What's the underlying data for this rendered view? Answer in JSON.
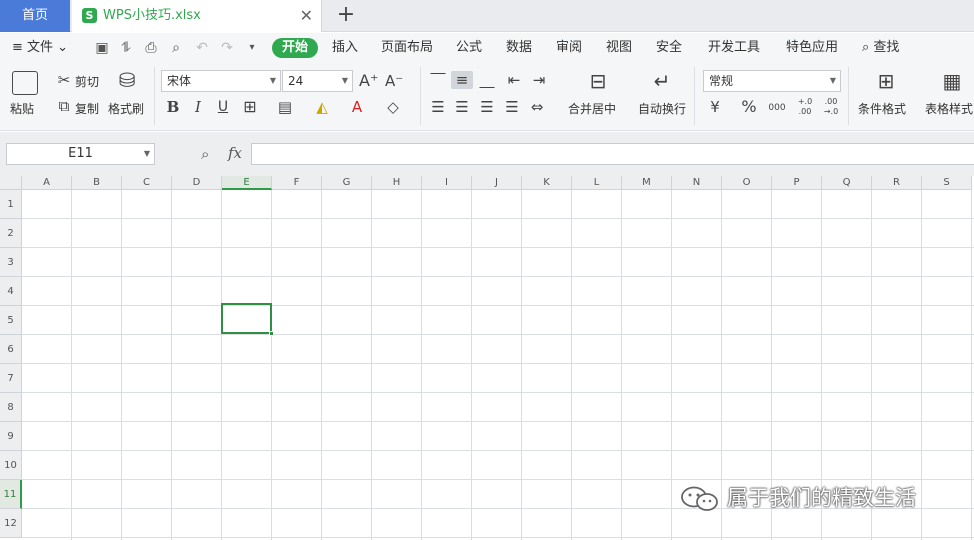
{
  "tabs": {
    "home": "首页",
    "file_name": "WPS小技巧.xlsx",
    "file_icon": "S"
  },
  "menu": {
    "file": "≡ 文件 ⌄",
    "tabs": [
      "开始",
      "插入",
      "页面布局",
      "公式",
      "数据",
      "审阅",
      "视图",
      "安全",
      "开发工具",
      "特色应用"
    ],
    "active_tab": "开始",
    "search": "查找"
  },
  "ribbon": {
    "paste": "粘贴",
    "cut": "剪切",
    "copy": "复制",
    "format_painter": "格式刷",
    "font_name": "宋体",
    "font_size": "24",
    "bold": "B",
    "italic": "I",
    "underline": "U",
    "merge_center": "合并居中",
    "wrap_text": "自动换行",
    "number_format": "常规",
    "conditional_format": "条件格式",
    "table_style": "表格样式",
    "percent": "%",
    "currency": "¥",
    "thousands": "000",
    "inc_decimal": "+.0 .00",
    "dec_decimal": ".00 →.0"
  },
  "formula_bar": {
    "name_box": "E11",
    "fx": "fx",
    "formula": ""
  },
  "grid": {
    "columns": [
      "A",
      "B",
      "C",
      "D",
      "E",
      "F",
      "G",
      "H",
      "I",
      "J",
      "K",
      "L",
      "M",
      "N",
      "O",
      "P",
      "Q",
      "R",
      "S"
    ],
    "rows": [
      "1",
      "2",
      "3",
      "4",
      "5",
      "6",
      "7",
      "8",
      "9",
      "10",
      "11",
      "12"
    ],
    "selected_column": "E",
    "selected_row": "11"
  },
  "watermark": {
    "text": "属于我们的精致生活"
  },
  "colors": {
    "accent_green": "#2fa84f",
    "home_tab_blue": "#4a7bd8",
    "selection_green": "#2f8f45"
  }
}
